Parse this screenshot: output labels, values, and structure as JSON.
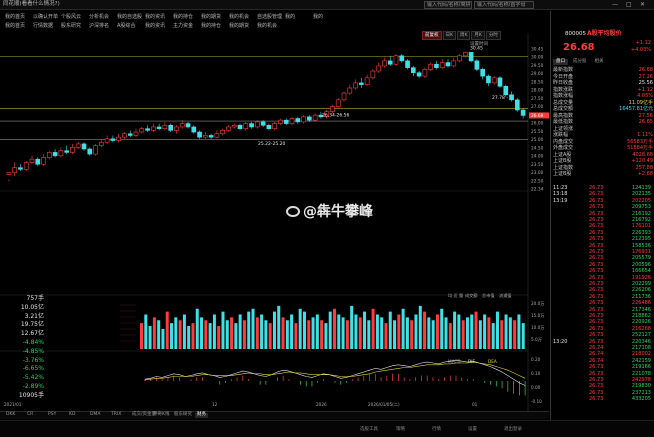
{
  "window": {
    "title": "同花顺(看看什么情况?)",
    "search_placeholder": "输入代码/名称/简拼",
    "search_button": "输入代码/名称/首字母",
    "controls": [
      "—",
      "□",
      "✕"
    ]
  },
  "menu": {
    "row1": [
      "我的首页",
      "以确认开单",
      "个股风云",
      "分析机会",
      "我的自选股",
      "我的资讯",
      "我的持仓",
      "我的期货",
      "我的机会",
      "自选股管理",
      "我的",
      "我的"
    ],
    "row2": [
      "我的首页",
      "行情数据",
      "股东研究",
      "沪深排名",
      "A股综合",
      "我的资讯",
      "主力资金",
      "我的持仓",
      "我的期货",
      "我的机会"
    ]
  },
  "toolbar": {
    "items": [
      "前复权",
      "日K",
      "周K",
      "月K",
      "分时"
    ],
    "active_index": 0
  },
  "chart": {
    "settings_label": "设置时间",
    "annotations": [
      {
        "text": "30.45"
      },
      {
        "text": "27.78 -"
      },
      {
        "text": "26.34-26.56"
      },
      {
        "text": "25.22-25.20"
      }
    ],
    "price_axis": [
      "30.45",
      "30.00",
      "29.50",
      "29.00",
      "28.50",
      "28.00",
      "27.50",
      "27.00",
      "26.50",
      "26.00",
      "25.50",
      "25.00",
      "24.50",
      "24.00",
      "23.50",
      "23.00",
      "22.50",
      "22.34"
    ],
    "current_price_tag": "26.68",
    "date_labels": [
      "2021/01",
      "",
      "",
      "",
      "12",
      "",
      "2026",
      "2026/01/05(二)",
      "",
      "01"
    ],
    "volume_header": [
      "均 近 量",
      "成交额",
      "总市值",
      "流通值"
    ],
    "macd_header": [
      "MACD",
      "DIF",
      "DEA"
    ],
    "macd_axis": [
      "0.20",
      "0.10",
      "0.00",
      "-0.10"
    ],
    "volume_axis": [
      "20.0万",
      "15.0万",
      "10.0万",
      "5.0万"
    ]
  },
  "watermark": "@犇牛攀峰",
  "chart_data": {
    "type": "candlestick",
    "ylim": [
      22.34,
      30.6
    ],
    "candles": [
      [
        23.2,
        23.3,
        22.9,
        22.8
      ],
      [
        23.3,
        23.6,
        23.9,
        23.1
      ],
      [
        23.6,
        23.5,
        23.8,
        23.4
      ],
      [
        23.5,
        23.9,
        24.0,
        23.4
      ],
      [
        23.9,
        24.1,
        24.3,
        23.8
      ],
      [
        24.1,
        23.8,
        24.2,
        23.7
      ],
      [
        23.8,
        24.2,
        24.4,
        23.7
      ],
      [
        24.2,
        24.5,
        24.6,
        24.1
      ],
      [
        24.5,
        24.3,
        24.7,
        24.2
      ],
      [
        24.3,
        24.6,
        24.8,
        24.2
      ],
      [
        24.6,
        24.5,
        24.9,
        24.4
      ],
      [
        24.5,
        24.8,
        25.0,
        24.4
      ],
      [
        24.8,
        25.0,
        25.1,
        24.7
      ],
      [
        25.0,
        24.7,
        25.1,
        24.6
      ],
      [
        24.7,
        24.4,
        24.8,
        24.3
      ],
      [
        24.4,
        24.9,
        25.0,
        24.3
      ],
      [
        24.9,
        25.1,
        25.3,
        24.8
      ],
      [
        25.1,
        25.3,
        25.5,
        25.0
      ],
      [
        25.3,
        25.2,
        25.5,
        25.1
      ],
      [
        25.2,
        25.4,
        25.6,
        25.1
      ],
      [
        25.4,
        25.6,
        25.7,
        25.3
      ],
      [
        25.6,
        25.5,
        25.8,
        25.4
      ],
      [
        25.5,
        25.7,
        25.9,
        25.4
      ],
      [
        25.7,
        25.9,
        26.0,
        25.6
      ],
      [
        25.9,
        25.8,
        26.1,
        25.7
      ],
      [
        25.8,
        26.0,
        26.2,
        25.7
      ],
      [
        26.0,
        25.9,
        26.2,
        25.8
      ],
      [
        25.9,
        26.1,
        26.3,
        25.8
      ],
      [
        26.1,
        25.8,
        26.2,
        25.7
      ],
      [
        25.8,
        26.0,
        26.1,
        25.6
      ],
      [
        26.0,
        26.2,
        26.4,
        25.9
      ],
      [
        26.2,
        26.0,
        26.3,
        25.9
      ],
      [
        26.0,
        25.7,
        26.1,
        25.6
      ],
      [
        25.7,
        25.4,
        25.8,
        25.3
      ],
      [
        25.4,
        25.5,
        25.7,
        25.3
      ],
      [
        25.5,
        25.4,
        25.6,
        25.3
      ],
      [
        25.4,
        25.6,
        25.8,
        25.35
      ],
      [
        25.6,
        25.8,
        25.9,
        25.5
      ],
      [
        25.8,
        26.0,
        26.1,
        25.7
      ],
      [
        26.0,
        26.1,
        26.2,
        25.9
      ],
      [
        26.1,
        25.9,
        26.2,
        25.8
      ],
      [
        25.9,
        26.2,
        26.3,
        25.8
      ],
      [
        26.2,
        26.0,
        26.3,
        25.9
      ],
      [
        26.0,
        26.3,
        26.4,
        25.9
      ],
      [
        26.3,
        26.1,
        26.4,
        26.0
      ],
      [
        26.1,
        25.9,
        26.2,
        25.8
      ],
      [
        25.9,
        26.2,
        26.3,
        25.8
      ],
      [
        26.2,
        26.4,
        26.5,
        26.1
      ],
      [
        26.4,
        26.2,
        26.5,
        26.1
      ],
      [
        26.2,
        26.5,
        26.6,
        26.1
      ],
      [
        26.5,
        26.3,
        26.6,
        26.2
      ],
      [
        26.3,
        26.6,
        26.7,
        26.2
      ],
      [
        26.6,
        26.4,
        26.7,
        26.3
      ],
      [
        26.4,
        26.7,
        26.8,
        26.3
      ],
      [
        26.7,
        26.6,
        26.9,
        26.5
      ],
      [
        26.6,
        26.9,
        27.0,
        26.5
      ],
      [
        26.9,
        27.2,
        27.3,
        26.8
      ],
      [
        27.2,
        27.6,
        27.7,
        27.1
      ],
      [
        27.6,
        28.0,
        28.1,
        27.5
      ],
      [
        28.0,
        28.3,
        28.5,
        27.9
      ],
      [
        28.3,
        28.6,
        28.8,
        28.2
      ],
      [
        28.6,
        28.5,
        28.9,
        28.3
      ],
      [
        28.5,
        28.9,
        29.1,
        28.4
      ],
      [
        28.9,
        29.3,
        29.4,
        28.8
      ],
      [
        29.3,
        29.6,
        29.8,
        29.2
      ],
      [
        29.6,
        29.9,
        30.1,
        29.5
      ],
      [
        29.9,
        29.7,
        30.2,
        29.6
      ],
      [
        29.7,
        30.2,
        30.3,
        29.6
      ],
      [
        30.2,
        29.9,
        30.3,
        29.8
      ],
      [
        29.9,
        29.5,
        30.0,
        29.4
      ],
      [
        29.5,
        29.2,
        29.6,
        29.0
      ],
      [
        29.2,
        29.0,
        29.3,
        28.9
      ],
      [
        29.0,
        29.4,
        29.5,
        28.9
      ],
      [
        29.4,
        29.7,
        29.8,
        29.3
      ],
      [
        29.7,
        29.5,
        29.9,
        29.4
      ],
      [
        29.5,
        29.8,
        30.0,
        29.4
      ],
      [
        29.8,
        29.6,
        30.0,
        29.5
      ],
      [
        29.6,
        29.9,
        30.1,
        29.5
      ],
      [
        29.9,
        30.2,
        30.3,
        29.8
      ],
      [
        30.2,
        30.4,
        30.45,
        30.1
      ],
      [
        30.4,
        29.9,
        30.4,
        29.8
      ],
      [
        29.9,
        29.4,
        30.0,
        29.3
      ],
      [
        29.4,
        29.0,
        29.5,
        28.8
      ],
      [
        29.0,
        28.6,
        29.1,
        28.4
      ],
      [
        28.6,
        28.9,
        29.0,
        28.5
      ],
      [
        28.9,
        28.4,
        29.0,
        28.3
      ],
      [
        28.4,
        27.9,
        28.5,
        27.78
      ],
      [
        27.9,
        27.6,
        28.1,
        27.5
      ],
      [
        27.6,
        27.0,
        27.7,
        26.9
      ],
      [
        27.0,
        26.68,
        27.1,
        26.5
      ]
    ],
    "volume": [
      9,
      12,
      8,
      11,
      10,
      7,
      13,
      9,
      11,
      10,
      12,
      8,
      9,
      14,
      11,
      10,
      9,
      12,
      8,
      13,
      10,
      11,
      9,
      12,
      10,
      13,
      14,
      11,
      12,
      10,
      9,
      13,
      15,
      11,
      10,
      12,
      9,
      14,
      13,
      10,
      11,
      12,
      10,
      9,
      13,
      14,
      12,
      11,
      10,
      15,
      12,
      11,
      13,
      10,
      14,
      12,
      11,
      9,
      13,
      10,
      12,
      14,
      11,
      10,
      12,
      15,
      13,
      11,
      10,
      12,
      14,
      11,
      9,
      13,
      12,
      10,
      11,
      12,
      13,
      10,
      12,
      11,
      9,
      13,
      10,
      12,
      11,
      10,
      12,
      9
    ],
    "dif": [
      0.02,
      0.03,
      0.05,
      0.04,
      0.06,
      0.08,
      0.07,
      0.05,
      0.06,
      0.08,
      0.09,
      0.07,
      0.06,
      0.04,
      0.05,
      0.07,
      0.09,
      0.11,
      0.1,
      0.08,
      0.06,
      0.05,
      0.07,
      0.1,
      0.12,
      0.11,
      0.09,
      0.07,
      0.05,
      0.04,
      0.06,
      0.08,
      0.07,
      0.05,
      0.03,
      0.04,
      0.06,
      0.08,
      0.1,
      0.12,
      0.14,
      0.13,
      0.15,
      0.17,
      0.18,
      0.17,
      0.16,
      0.18,
      0.2,
      0.21,
      0.2,
      0.19,
      0.21,
      0.22,
      0.23,
      0.22,
      0.21,
      0.22,
      0.2,
      0.18,
      0.16,
      0.13,
      0.1,
      0.06,
      0.02,
      -0.02,
      -0.05
    ],
    "dea": [
      0.01,
      0.02,
      0.03,
      0.03,
      0.04,
      0.05,
      0.05,
      0.05,
      0.05,
      0.06,
      0.07,
      0.07,
      0.06,
      0.06,
      0.06,
      0.06,
      0.07,
      0.08,
      0.09,
      0.08,
      0.08,
      0.07,
      0.07,
      0.08,
      0.09,
      0.1,
      0.09,
      0.09,
      0.08,
      0.07,
      0.07,
      0.07,
      0.07,
      0.06,
      0.05,
      0.05,
      0.05,
      0.06,
      0.07,
      0.08,
      0.1,
      0.11,
      0.12,
      0.13,
      0.14,
      0.15,
      0.15,
      0.16,
      0.17,
      0.18,
      0.18,
      0.18,
      0.19,
      0.19,
      0.2,
      0.2,
      0.2,
      0.21,
      0.2,
      0.19,
      0.18,
      0.16,
      0.14,
      0.12,
      0.09,
      0.06,
      0.03
    ]
  },
  "left_values": [
    {
      "text": "757手",
      "color": "white"
    },
    {
      "text": "10.05亿",
      "color": "white"
    },
    {
      "text": "3.21亿",
      "color": "white"
    },
    {
      "text": "19.75亿",
      "color": "white"
    },
    {
      "text": "12.67亿",
      "color": "white"
    },
    {
      "text": "-4.84%",
      "color": "green"
    },
    {
      "text": "-4.85%",
      "color": "green"
    },
    {
      "text": "-3.76%",
      "color": "green"
    },
    {
      "text": "-6.65%",
      "color": "green"
    },
    {
      "text": "-5.42%",
      "color": "green"
    },
    {
      "text": "-2.89%",
      "color": "green"
    },
    {
      "text": "10905手",
      "color": "white"
    }
  ],
  "bottom_tabs": {
    "items": [
      "DKK",
      "CR",
      "PSY",
      "KD",
      "DMA",
      "TRIX",
      "成交/资金量",
      "神奇K线",
      "股东研究",
      "财务"
    ],
    "active_index": 9
  },
  "taskbar": [
    "选股工具",
    "策略",
    "行情",
    "设置",
    "退出登录"
  ],
  "quote": {
    "code": "800005",
    "name": "A股平均股价",
    "price": "26.68",
    "change": "+1.12",
    "pct": "+4.03%",
    "tabs": [
      "盘口",
      "成分股",
      "相关"
    ],
    "active_tab": 0,
    "fields": [
      {
        "k": "最新指数",
        "v": "26.68",
        "c": "red"
      },
      {
        "k": "今日开盘",
        "v": "27.26",
        "c": "red"
      },
      {
        "k": "昨日收盘",
        "v": "25.56",
        "c": "white"
      },
      {
        "k": "指数涨跌",
        "v": "+1.12",
        "c": "red"
      },
      {
        "k": "指数涨幅",
        "v": "4.03%",
        "c": "red"
      },
      {
        "k": "总成交量",
        "v": "11.09亿手",
        "c": "yellow"
      },
      {
        "k": "总成交额",
        "v": "16457.81亿元",
        "c": "cyan"
      },
      {
        "k": "最高指数",
        "v": "27.56",
        "c": "red"
      },
      {
        "k": "最低指数",
        "v": "26.65",
        "c": "red"
      },
      {
        "k": "上证领涨",
        "v": "",
        "c": "white"
      },
      {
        "k": "涨跌幅",
        "v": "1.11%",
        "c": "red"
      },
      {
        "k": "内盘成交",
        "v": "56583万手",
        "c": "red"
      },
      {
        "k": "外盘成交",
        "v": "51884万手",
        "c": "red"
      },
      {
        "k": "上证A股",
        "v": "4028.68",
        "c": "red"
      },
      {
        "k": "上证B股",
        "v": "+120.49",
        "c": "red"
      },
      {
        "k": "上证指数",
        "v": "257.88",
        "c": "red"
      },
      {
        "k": "上证B股",
        "v": "+2.68",
        "c": "red"
      }
    ],
    "ticks": [
      {
        "t": "11:23",
        "p": "26.73",
        "v": "124139"
      },
      {
        "t": "13:18",
        "p": "26.73",
        "v": "202135"
      },
      {
        "t": "13:19",
        "p": "26.73",
        "v": "202205"
      },
      {
        "t": "",
        "p": "26.73",
        "v": "209753"
      },
      {
        "t": "",
        "p": "26.73",
        "v": "216192"
      },
      {
        "t": "",
        "p": "26.73",
        "v": "216792"
      },
      {
        "t": "",
        "p": "26.73",
        "v": "176101"
      },
      {
        "t": "",
        "p": "26.73",
        "v": "226393"
      },
      {
        "t": "",
        "p": "26.73",
        "v": "212395"
      },
      {
        "t": "",
        "p": "26.73",
        "v": "158536"
      },
      {
        "t": "",
        "p": "26.73",
        "v": "176931"
      },
      {
        "t": "",
        "p": "26.73",
        "v": "205579"
      },
      {
        "t": "",
        "p": "26.73",
        "v": "200596"
      },
      {
        "t": "",
        "p": "26.73",
        "v": "166654"
      },
      {
        "t": "",
        "p": "26.73",
        "v": "191926"
      },
      {
        "t": "",
        "p": "26.73",
        "v": "202299"
      },
      {
        "t": "",
        "p": "26.73",
        "v": "226206"
      },
      {
        "t": "",
        "p": "26.73",
        "v": "211736"
      },
      {
        "t": "",
        "p": "26.73",
        "v": "226486"
      },
      {
        "t": "",
        "p": "26.73",
        "v": "217346"
      },
      {
        "t": "",
        "p": "26.73",
        "v": "218862"
      },
      {
        "t": "",
        "p": "26.73",
        "v": "220926"
      },
      {
        "t": "",
        "p": "26.73",
        "v": "216268"
      },
      {
        "t": "",
        "p": "26.73",
        "v": "252127"
      },
      {
        "t": "13:20",
        "p": "26.73",
        "v": "220346"
      },
      {
        "t": "",
        "p": "26.74",
        "v": "217108"
      },
      {
        "t": "",
        "p": "26.74",
        "v": "218002"
      },
      {
        "t": "",
        "p": "26.74",
        "v": "242159"
      },
      {
        "t": "",
        "p": "26.73",
        "v": "219166"
      },
      {
        "t": "",
        "p": "26.73",
        "v": "221078"
      },
      {
        "t": "",
        "p": "26.73",
        "v": "242978"
      },
      {
        "t": "",
        "p": "26.73",
        "v": "219830"
      },
      {
        "t": "",
        "p": "26.73",
        "v": "237213"
      },
      {
        "t": "",
        "p": "26.73",
        "v": "433205"
      }
    ]
  }
}
